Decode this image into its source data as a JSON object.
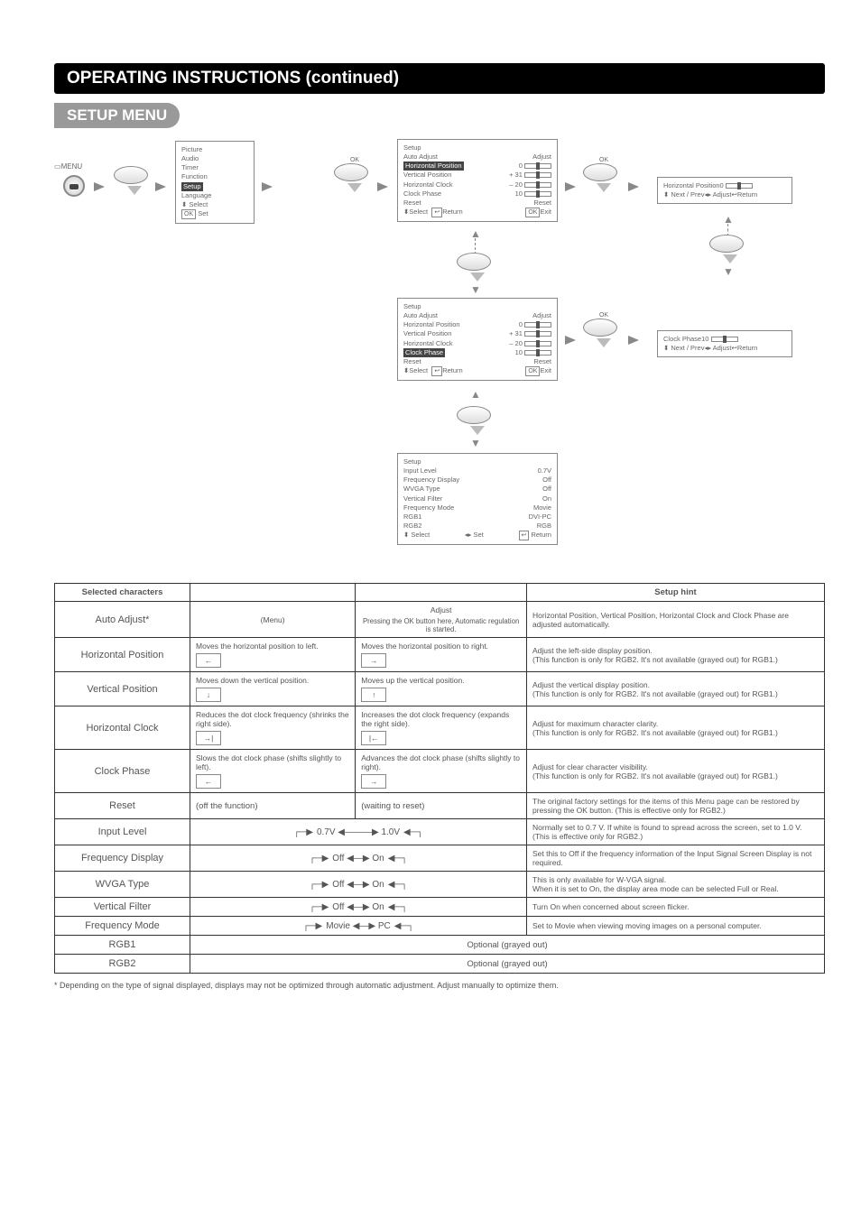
{
  "title_bar": "OPERATING INSTRUCTIONS (continued)",
  "section_label": "SETUP MENU",
  "menu_button_label": "MENU",
  "ok_label": "OK",
  "panel1": {
    "items": [
      "Picture",
      "Audio",
      "Timer",
      "Function"
    ],
    "highlight": "Setup",
    "after": [
      "Language"
    ],
    "footer_select": "Select",
    "footer_set": "Set",
    "footer_set_box": "OK"
  },
  "panel2": {
    "title": "Setup",
    "rows": [
      {
        "l": "Auto Adjust",
        "r": "Adjust"
      },
      {
        "l": "Horizontal Position",
        "r": "0",
        "hl": true
      },
      {
        "l": "Vertical Position",
        "r": "+ 31"
      },
      {
        "l": "Horizontal Clock",
        "r": "– 20"
      },
      {
        "l": "Clock Phase",
        "r": "10"
      },
      {
        "l": "Reset",
        "r": "Reset"
      }
    ],
    "footer_l": "Select",
    "footer_m": "Return",
    "footer_r": "Exit",
    "footer_r_box": "OK"
  },
  "panel3": {
    "title": "Setup",
    "rows": [
      {
        "l": "Auto Adjust",
        "r": "Adjust"
      },
      {
        "l": "Horizontal Position",
        "r": "0"
      },
      {
        "l": "Vertical Position",
        "r": "+ 31"
      },
      {
        "l": "Horizontal Clock",
        "r": "– 20"
      },
      {
        "l": "Clock Phase",
        "r": "10",
        "hl": true
      },
      {
        "l": "Reset",
        "r": "Reset"
      }
    ],
    "footer_l": "Select",
    "footer_m": "Return",
    "footer_r": "Exit",
    "footer_r_box": "OK"
  },
  "panel4": {
    "title": "Setup",
    "rows": [
      {
        "l": "Input Level",
        "r": "0.7V"
      },
      {
        "l": "Frequency Display",
        "r": "Off"
      },
      {
        "l": "WVGA Type",
        "r": "Off"
      },
      {
        "l": "Vertical Filter",
        "r": "On"
      },
      {
        "l": "Frequency Mode",
        "r": "Movie"
      },
      {
        "l": "RGB1",
        "r": "DVI-PC"
      },
      {
        "l": "RGB2",
        "r": "RGB"
      }
    ],
    "footer_l": "Select",
    "footer_m": "Set",
    "footer_r": "Return"
  },
  "side_panel_a": {
    "line1": "Horizontal Position",
    "val": "0",
    "f1": "Next / Prev",
    "f2": "Adjust",
    "f3": "Return"
  },
  "side_panel_b": {
    "line1": "Clock Phase",
    "val": "10",
    "f1": "Next / Prev",
    "f2": "Adjust",
    "f3": "Return"
  },
  "table": {
    "headers": [
      "Selected characters",
      "",
      "",
      "Setup hint"
    ],
    "rows": [
      {
        "label": "Auto Adjust*",
        "c2_top": "(Menu)",
        "c3_top": "Adjust",
        "c3_sub": "Pressing the OK button here, Automatic regulation is started.",
        "hint": "Horizontal Position, Vertical Position, Horizontal Clock and Clock Phase are adjusted automatically."
      },
      {
        "label": "Horizontal Position",
        "c2": "Moves the horizontal position to left.",
        "c3": "Moves the horizontal position to right.",
        "box_l": "←",
        "box_r": "→",
        "hint": "Adjust the left-side display position.\n(This function is only for RGB2. It's not available (grayed out) for RGB1.)"
      },
      {
        "label": "Vertical Position",
        "c2": "Moves down the vertical position.",
        "c3": "Moves up the vertical position.",
        "box_l": "↓",
        "box_r": "↑",
        "hint": "Adjust the vertical display position.\n(This function is only for RGB2. It's not available (grayed out) for RGB1.)"
      },
      {
        "label": "Horizontal Clock",
        "c2": "Reduces the dot clock frequency (shrinks the right side).",
        "c3": "Increases the dot clock frequency (expands the right side).",
        "box_l": "→|",
        "box_r": "|←",
        "hint": "Adjust for maximum character clarity.\n(This function is only for RGB2. It's not available (grayed out) for RGB1.)"
      },
      {
        "label": "Clock Phase",
        "c2": "Slows the dot clock phase (shifts slightly to left).",
        "c3": "Advances the dot clock phase (shifts slightly to right).",
        "box_l": "←",
        "box_r": "→",
        "hint": "Adjust for clear character visibility.\n(This function is only for RGB2. It's not available (grayed out) for RGB1.)"
      },
      {
        "label": "Reset",
        "c2_plain": "(off the function)",
        "c3_plain": "(waiting to reset)",
        "hint": "The original factory settings for the items of this Menu page can be restored by pressing the OK button. (This is effective only for RGB2.)"
      },
      {
        "label": "Input Level",
        "cycle": "0.7V ◀———▶ 1.0V",
        "hint": "Normally set to 0.7 V. If white is found to spread across the screen, set to 1.0 V. (This is effective only for RGB2.)"
      },
      {
        "label": "Frequency Display",
        "cycle": "Off ◀—▶ On",
        "hint": "Set this to Off if the frequency information of the Input Signal Screen Display is not required."
      },
      {
        "label": "WVGA Type",
        "cycle": "Off ◀—▶ On",
        "hint": "This is only available for W-VGA signal.\nWhen it is set to On, the display area mode can be selected Full or Real."
      },
      {
        "label": "Vertical Filter",
        "cycle": "Off ◀—▶ On",
        "hint": "Turn On when concerned about screen flicker."
      },
      {
        "label": "Frequency Mode",
        "cycle": "Movie ◀—▶ PC",
        "hint": "Set to Movie when viewing moving images on a personal computer."
      },
      {
        "label": "RGB1",
        "span_text": "Optional (grayed out)"
      },
      {
        "label": "RGB2",
        "span_text": "Optional (grayed out)"
      }
    ]
  },
  "footnote": "*  Depending on the type of signal displayed, displays may not be optimized through automatic adjustment. Adjust manually to optimize them."
}
